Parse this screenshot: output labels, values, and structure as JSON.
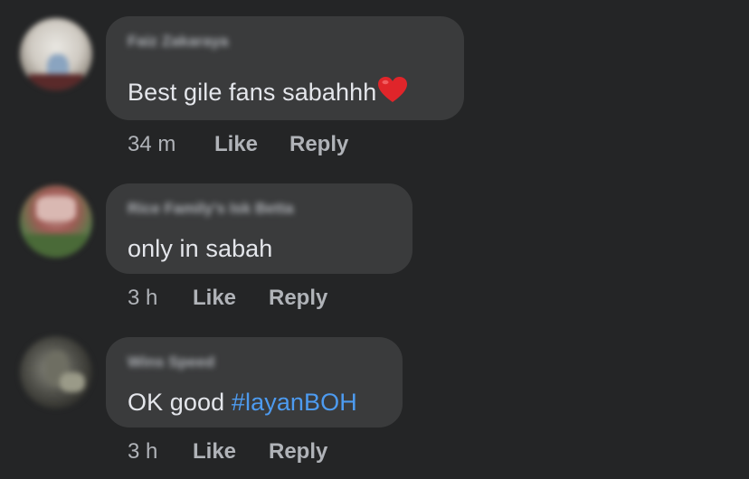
{
  "comments": [
    {
      "author": "Faiz Zakaraya",
      "text": "Best gile fans sabahhh",
      "emoji": "red-heart",
      "time": "34 m",
      "like_label": "Like",
      "reply_label": "Reply"
    },
    {
      "author": "Rice Family's Isk Betta",
      "text": "only in sabah",
      "time": "3 h",
      "like_label": "Like",
      "reply_label": "Reply"
    },
    {
      "author": "Wins Speed",
      "text_prefix": "OK good ",
      "hashtag": "#layanBOH",
      "time": "3 h",
      "like_label": "Like",
      "reply_label": "Reply"
    }
  ],
  "colors": {
    "background": "#242526",
    "bubble": "#3a3b3c",
    "text": "#e4e6eb",
    "secondary_text": "#b0b3b8",
    "hashtag": "#4d9bf0",
    "heart": "#e0252a"
  }
}
